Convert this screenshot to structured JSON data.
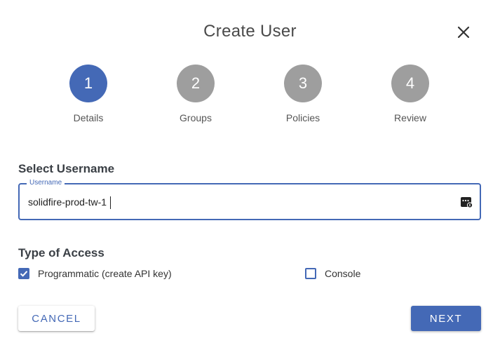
{
  "dialog": {
    "title": "Create User"
  },
  "stepper": {
    "steps": [
      {
        "number": "1",
        "label": "Details",
        "active": true
      },
      {
        "number": "2",
        "label": "Groups",
        "active": false
      },
      {
        "number": "3",
        "label": "Policies",
        "active": false
      },
      {
        "number": "4",
        "label": "Review",
        "active": false
      }
    ]
  },
  "username_section": {
    "title": "Select Username",
    "field_label": "Username",
    "field_value": "solidfire-prod-tw-1",
    "icon": "password-manager-icon"
  },
  "access_section": {
    "title": "Type of Access",
    "options": [
      {
        "label": "Programmatic (create API key)",
        "checked": true
      },
      {
        "label": "Console",
        "checked": false
      }
    ]
  },
  "actions": {
    "cancel_label": "CANCEL",
    "next_label": "NEXT"
  },
  "colors": {
    "primary": "#4469b6",
    "inactive_step": "#9e9e9e"
  }
}
